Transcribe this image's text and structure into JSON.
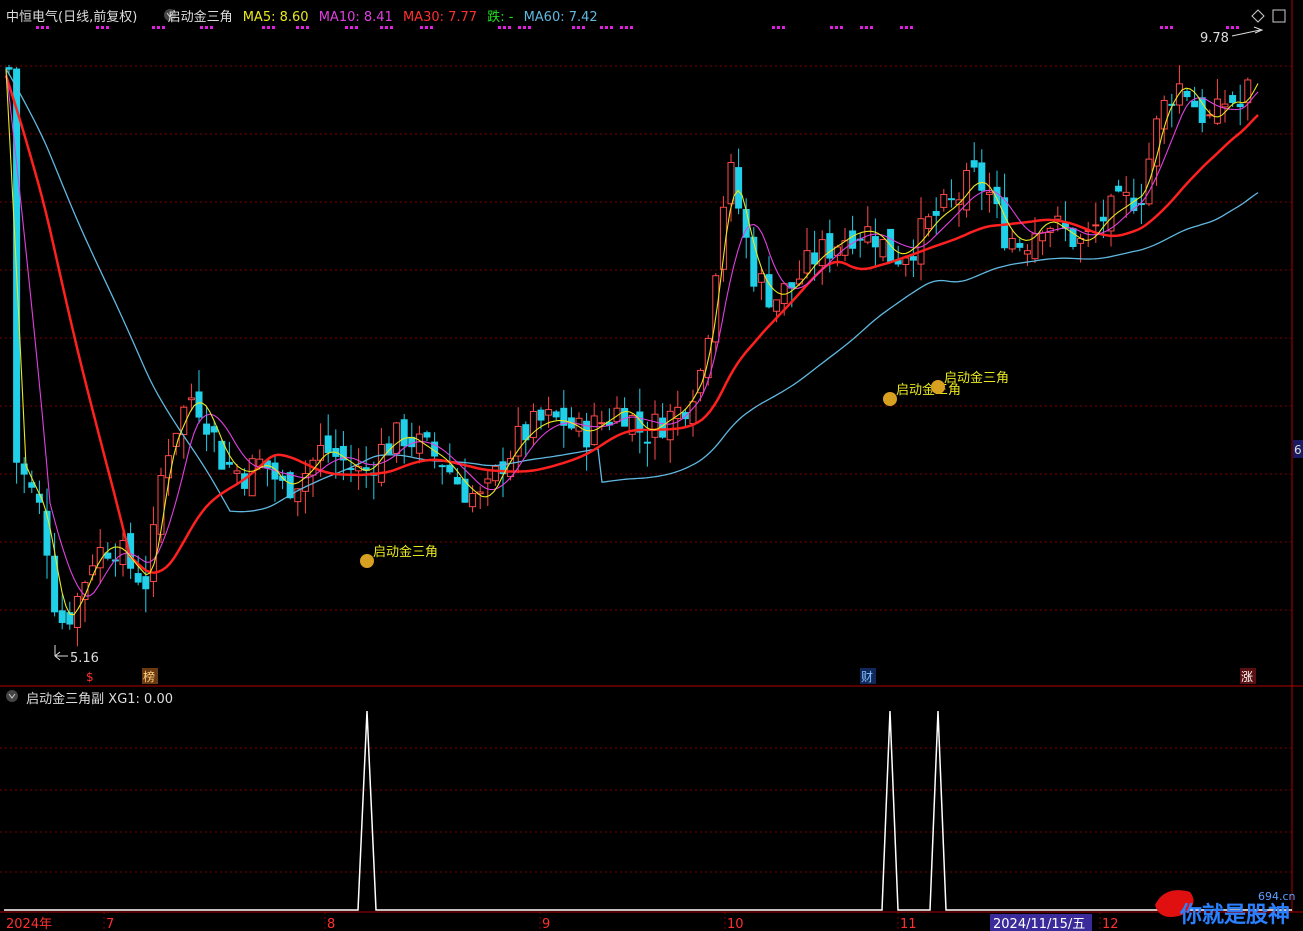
{
  "header": {
    "stock_title": "中恒电气(日线,前复权)",
    "indicator_name": "启动金三角",
    "ma5": "MA5: 8.60",
    "ma10": "MA10: 8.41",
    "ma30": "MA30: 7.77",
    "fall": "跌: -",
    "ma60": "MA60: 7.42"
  },
  "main_chart": {
    "high_label": "9.78",
    "low_label": "5.16",
    "right_edge_label": "6",
    "signal_label": "启动金三角",
    "markers": {
      "bang": "榜",
      "cai": "财",
      "zhang": "涨",
      "s": "$"
    }
  },
  "sub_chart": {
    "name": "启动金三角副",
    "value": "XG1: 0.00"
  },
  "x_axis": {
    "labels": [
      "2024年",
      "7",
      "8",
      "9",
      "10",
      "11",
      "2024/11/15/五",
      "12"
    ]
  },
  "watermark": {
    "text": "你就是股神",
    "site": "694.cn"
  },
  "colors": {
    "up": "#ff4a4a",
    "down": "#20d0e8",
    "ma5": "#e8e820",
    "ma10": "#e040e0",
    "ma30": "#ff2020",
    "ma60": "#60b8e0",
    "grid": "#800000"
  }
}
